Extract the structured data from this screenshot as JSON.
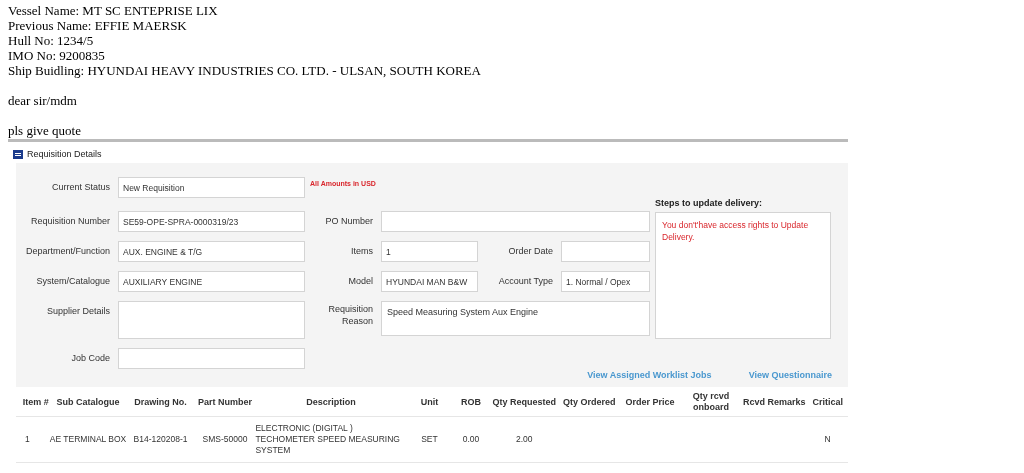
{
  "email": {
    "details": [
      "Vessel Name: MT SC ENTEPRISE LIX",
      "Previous Name: EFFIE MAERSK",
      "Hull No: 1234/5",
      "IMO No: 9200835",
      "Ship Buidling: HYUNDAI HEAVY INDUSTRIES CO. LTD. - ULSAN, SOUTH KOREA"
    ],
    "greeting": "dear sir/mdm",
    "body": "pls give quote"
  },
  "app": {
    "title": "Requisition Details",
    "currency_note": "All Amounts in USD",
    "current_status": {
      "label": "Current Status",
      "value": "New Requisition"
    },
    "requisition_number": {
      "label": "Requisition Number",
      "value": "SE59-OPE-SPRA-0000319/23"
    },
    "po_number": {
      "label": "PO Number"
    },
    "department": {
      "label": "Department/Function",
      "value": "AUX. ENGINE & T/G"
    },
    "items": {
      "label": "Items",
      "value": "1"
    },
    "order_date": {
      "label": "Order Date"
    },
    "system": {
      "label": "System/Catalogue",
      "value": "AUXILIARY ENGINE"
    },
    "model": {
      "label": "Model",
      "value": "HYUNDAI MAN B&W"
    },
    "account_type": {
      "label": "Account Type",
      "value": "1. Normal / Opex"
    },
    "supplier_details": {
      "label": "Supplier Details"
    },
    "requisition_reason": {
      "label": "Requisition Reason",
      "value": "Speed Measuring System Aux Engine"
    },
    "job_code": {
      "label": "Job Code"
    },
    "delivery": {
      "heading": "Steps to update delivery:",
      "message": "You don't'have access rights to Update Delivery."
    },
    "links": [
      "View Assigned Worklist Jobs",
      "View Questionnaire"
    ],
    "table": {
      "columns": [
        "Item #",
        "Sub Catalogue",
        "Drawing No.",
        "Part Number",
        "Description",
        "Unit",
        "ROB",
        "Qty Requested",
        "Qty Ordered",
        "Order Price",
        "Qty rcvd onboard",
        "Rcvd Remarks",
        "Critical"
      ],
      "rows": [
        {
          "cells": [
            "1",
            "AE TERMINAL BOX",
            "B14-120208-1",
            "SMS-50000",
            "ELECTRONIC (DIGITAL ) TECHOMETER SPEED MEASURING SYSTEM",
            "SET",
            "0.00",
            "2.00",
            "",
            "",
            "",
            "",
            "N"
          ]
        }
      ]
    }
  }
}
